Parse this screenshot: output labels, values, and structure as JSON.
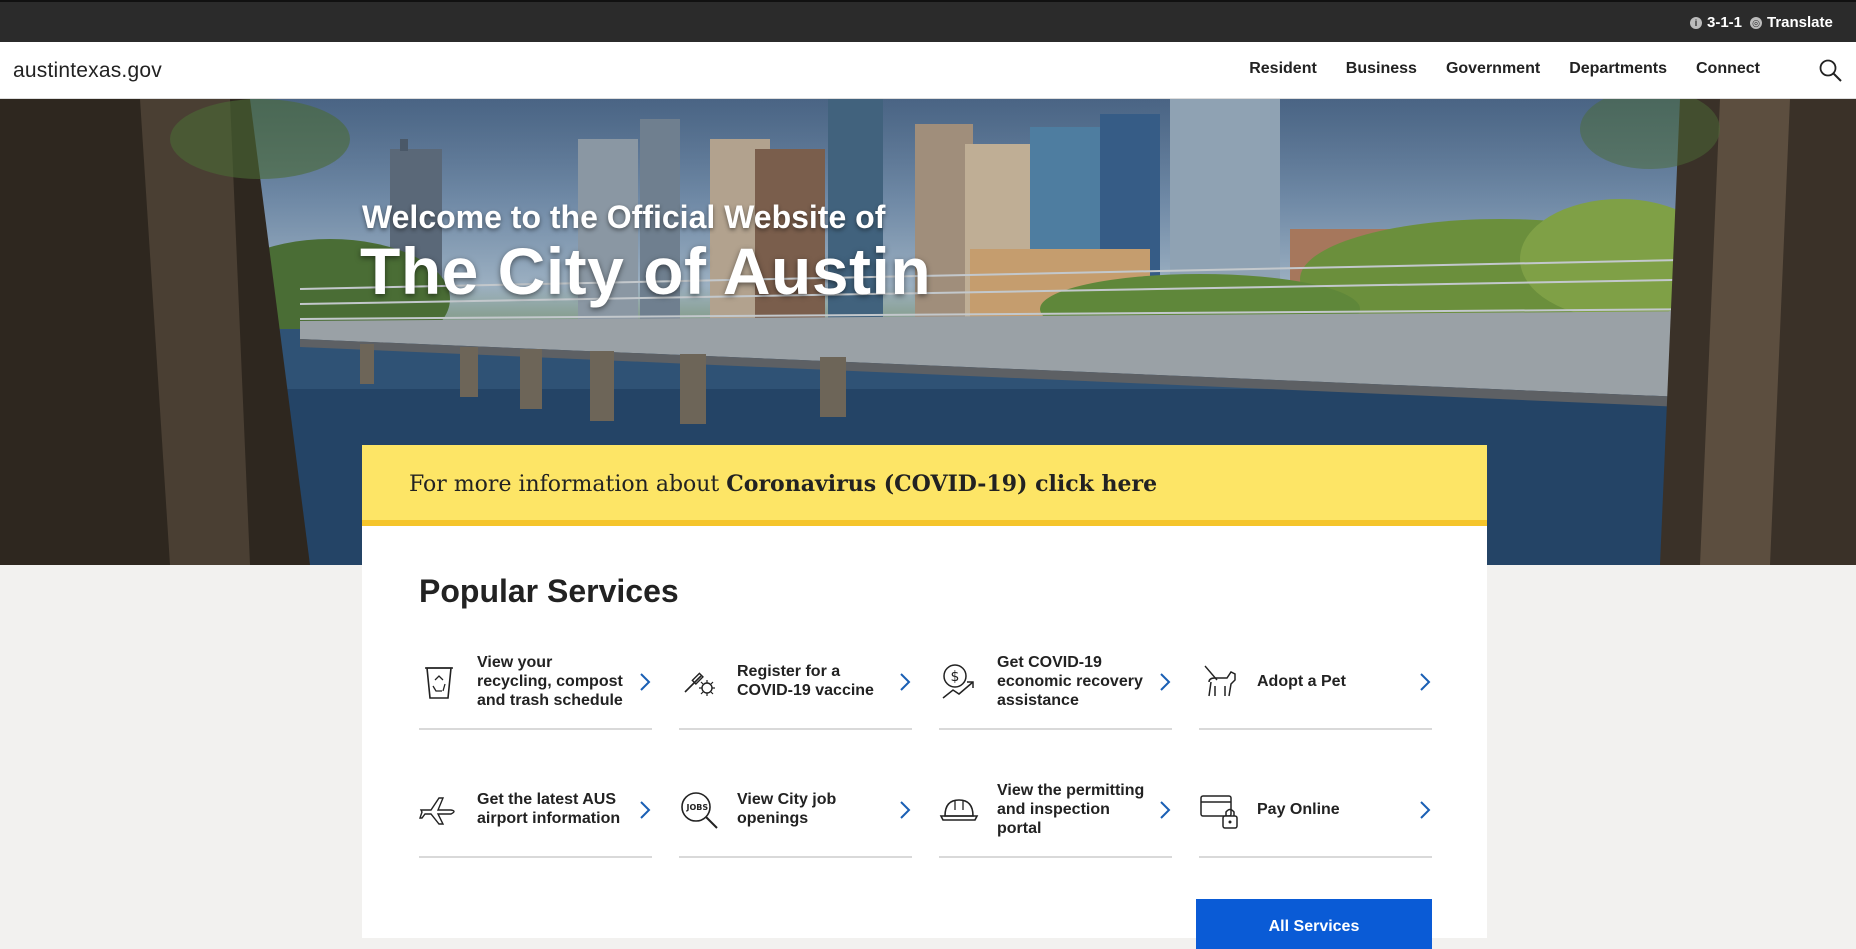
{
  "utility": {
    "phone_label": "3-1-1",
    "translate_label": "Translate"
  },
  "header": {
    "logo": "austintexas.gov",
    "nav": [
      "Resident",
      "Business",
      "Government",
      "Departments",
      "Connect"
    ]
  },
  "hero": {
    "subtitle": "Welcome to the Official Website of",
    "title": "The City of Austin"
  },
  "alert": {
    "prefix": "For more information about ",
    "link": "Coronavirus (COVID-19) click here"
  },
  "services": {
    "title": "Popular Services",
    "items": [
      {
        "label": "View your recycling, compost and trash schedule",
        "icon": "recycling-bin-icon"
      },
      {
        "label": "Register for a COVID-19 vaccine",
        "icon": "vaccine-icon"
      },
      {
        "label": "Get COVID-19 economic recovery assistance",
        "icon": "economic-recovery-icon"
      },
      {
        "label": "Adopt a Pet",
        "icon": "pet-icon"
      },
      {
        "label": "Get the latest AUS airport information",
        "icon": "airplane-icon"
      },
      {
        "label": "View City job openings",
        "icon": "jobs-search-icon"
      },
      {
        "label": "View the permitting and inspection portal",
        "icon": "hard-hat-icon"
      },
      {
        "label": "Pay Online",
        "icon": "online-payment-icon"
      }
    ],
    "all_button": "All Services"
  },
  "colors": {
    "utility_bg": "#2b2b2b",
    "alert_bg": "#fde566",
    "alert_border": "#f5c52b",
    "accent_blue": "#0a5bd6",
    "arrow_blue": "#1a5fb4"
  }
}
